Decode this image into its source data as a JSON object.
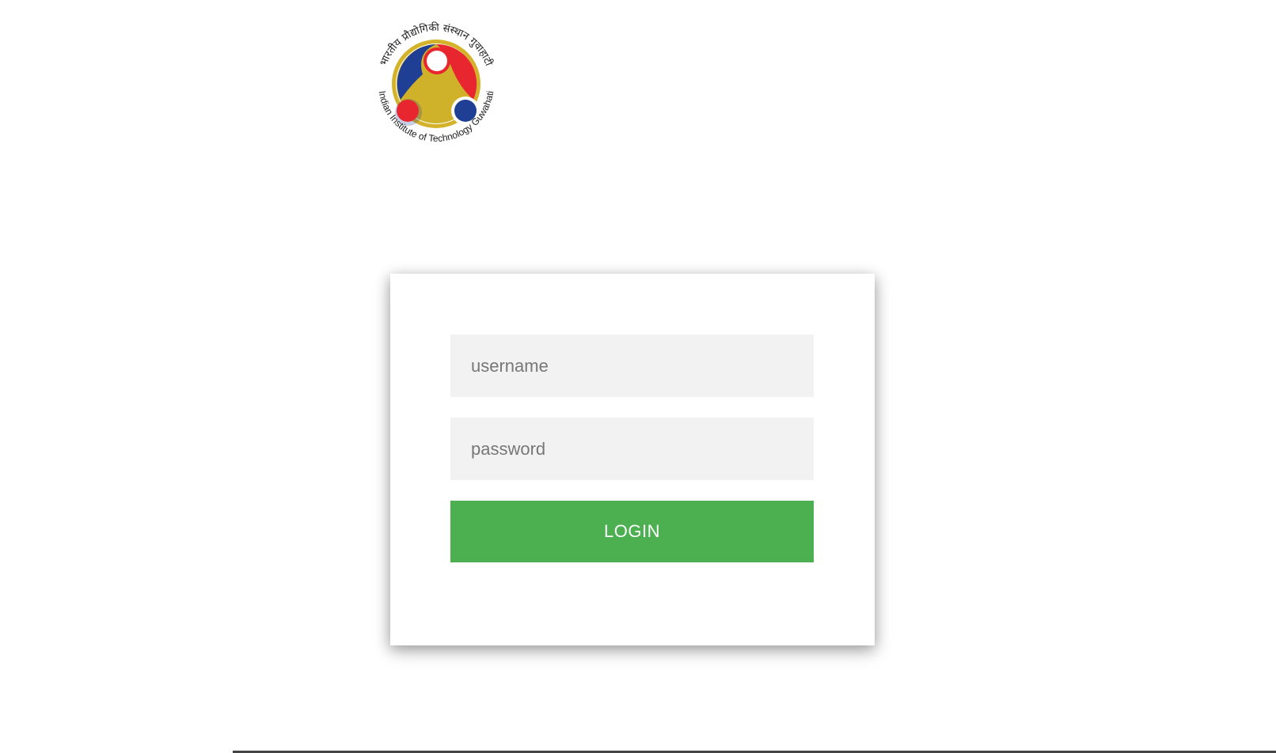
{
  "header": {
    "logo": {
      "icon": "iit-guwahati-emblem-icon",
      "text_hindi": "भारतीय प्रौद्योगिकी संस्थान गुवाहाटी",
      "text_english": "Indian Institute of Technology Guwahati",
      "colors": {
        "ring": "#d4b22a",
        "blue": "#1f3f94",
        "red": "#e8262f",
        "yellow": "#cfb22a"
      }
    }
  },
  "login": {
    "username_placeholder": "username",
    "password_placeholder": "password",
    "username_value": "",
    "password_value": "",
    "button_label": "LOGIN",
    "button_color": "#4caf50"
  }
}
